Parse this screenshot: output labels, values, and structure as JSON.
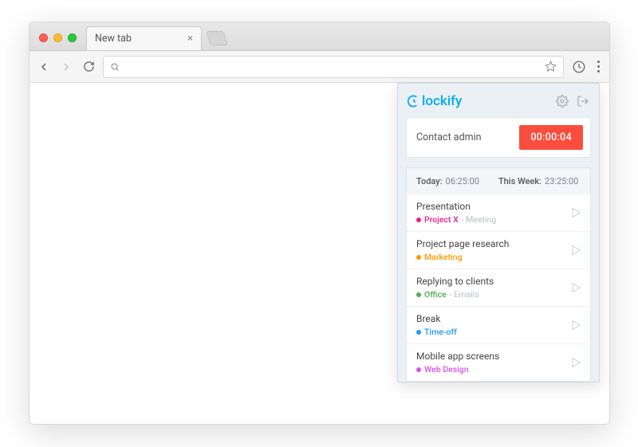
{
  "browser": {
    "tab_title": "New tab",
    "omnibox_value": ""
  },
  "popup": {
    "brand": "lockify",
    "tracker": {
      "title": "Contact admin",
      "timer": "00:00:04"
    },
    "summary": {
      "today_label": "Today:",
      "today_value": "06:25:00",
      "week_label": "This Week:",
      "week_value": "23:25:00"
    },
    "entries": [
      {
        "title": "Presentation",
        "project": "Project X",
        "task": "Meeting",
        "color": "#e91e8c"
      },
      {
        "title": "Project page research",
        "project": "Marketing",
        "task": "",
        "color": "#ff9800"
      },
      {
        "title": "Replying to clients",
        "project": "Office",
        "task": "Emails",
        "color": "#4caf50"
      },
      {
        "title": "Break",
        "project": "Time-off",
        "task": "",
        "color": "#2196f3"
      },
      {
        "title": "Mobile app screens",
        "project": "Web Design",
        "task": "",
        "color": "#d552e8"
      }
    ]
  }
}
